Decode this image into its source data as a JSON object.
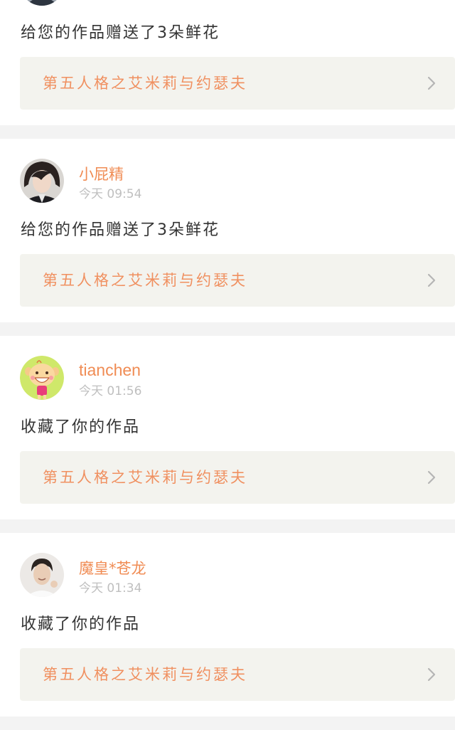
{
  "notifications": [
    {
      "username": "",
      "time": "",
      "action": "给您的作品赠送了3朵鲜花",
      "work_title": "第五人格之艾米莉与约瑟夫",
      "avatar_icon": "photo-avatar-icon"
    },
    {
      "username": "小屁精",
      "time": "今天 09:54",
      "action": "给您的作品赠送了3朵鲜花",
      "work_title": "第五人格之艾米莉与约瑟夫",
      "avatar_icon": "photo-avatar-icon"
    },
    {
      "username": "tianchen",
      "time": "今天 01:56",
      "action": "收藏了你的作品",
      "work_title": "第五人格之艾米莉与约瑟夫",
      "avatar_icon": "cartoon-avatar-icon"
    },
    {
      "username": "魔皇*苍龙",
      "time": "今天 01:34",
      "action": "收藏了你的作品",
      "work_title": "第五人格之艾米莉与约瑟夫",
      "avatar_icon": "photo-avatar-icon"
    }
  ],
  "colors": {
    "accent": "#f08c54",
    "link_background": "#f3f3ee",
    "page_background": "#f3f3f3",
    "time_text": "#bfbfbf",
    "action_text": "#333333"
  },
  "chevron_icon": "chevron-right-icon"
}
